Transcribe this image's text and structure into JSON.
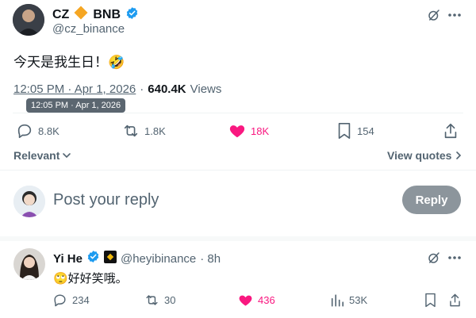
{
  "colors": {
    "accent": "#1d9bf0",
    "like": "#f91880",
    "muted": "#536471",
    "text": "#0f1419"
  },
  "tweet": {
    "author_name": "CZ",
    "author_badge_text": "BNB",
    "author_handle": "@cz_binance",
    "text": "今天是我生日！🤣",
    "time": "12:05 PM · Apr 1, 2026",
    "separator": "·",
    "views": "640.4K",
    "views_label": "Views",
    "tooltip": "12:05 PM · Apr 1, 2026",
    "stats": {
      "replies": "8.8K",
      "reposts": "1.8K",
      "likes": "18K",
      "bookmarks": "154"
    }
  },
  "sort": {
    "label": "Relevant"
  },
  "view_quotes": {
    "label": "View quotes"
  },
  "composer": {
    "placeholder": "Post your reply",
    "button": "Reply"
  },
  "reply": {
    "author_name": "Yi He",
    "author_handle": "@heyibinance",
    "time": "· 8h",
    "text": "🙄好好笑哦。",
    "stats": {
      "replies": "234",
      "reposts": "30",
      "likes": "436",
      "views": "53K"
    }
  }
}
